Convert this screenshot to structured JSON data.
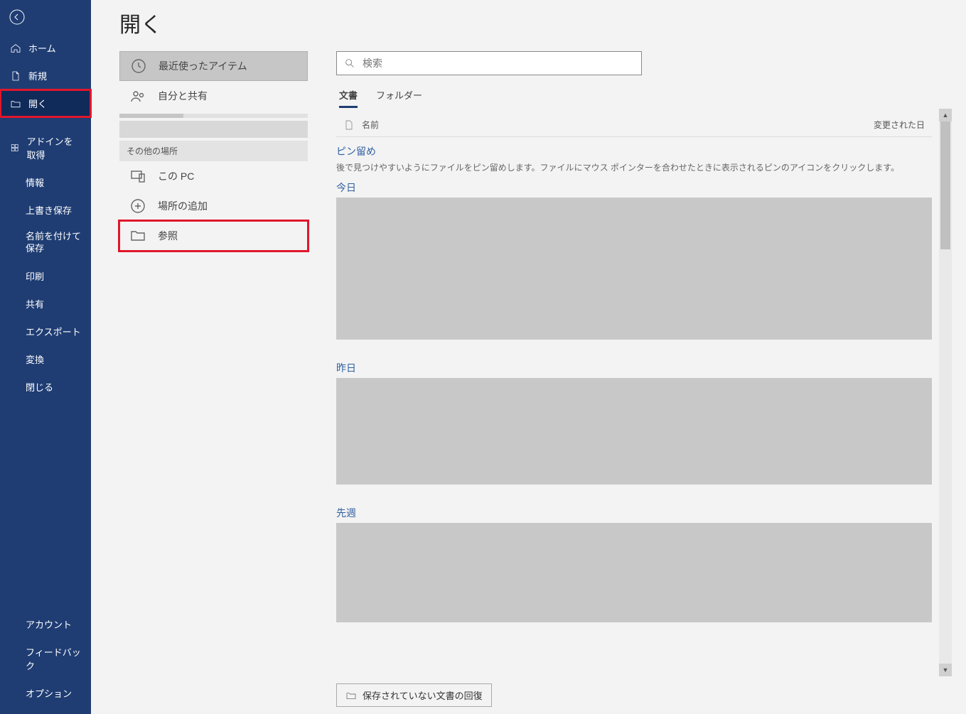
{
  "page_title": "開く",
  "sidebar": {
    "home": "ホーム",
    "new": "新規",
    "open": "開く",
    "addins": "アドインを取得",
    "info": "情報",
    "save": "上書き保存",
    "save_as": "名前を付けて保存",
    "print": "印刷",
    "share": "共有",
    "export": "エクスポート",
    "transform": "変換",
    "close": "閉じる",
    "account": "アカウント",
    "feedback": "フィードバック",
    "options": "オプション"
  },
  "locations": {
    "recent": "最近使ったアイテム",
    "shared": "自分と共有",
    "other_heading": "その他の場所",
    "this_pc": "この PC",
    "add_place": "場所の追加",
    "browse": "参照"
  },
  "right": {
    "search_placeholder": "検索",
    "tabs": {
      "documents": "文書",
      "folders": "フォルダー"
    },
    "columns": {
      "name": "名前",
      "modified": "変更された日"
    },
    "pinned_heading": "ピン留め",
    "pinned_desc": "後で見つけやすいようにファイルをピン留めします。ファイルにマウス ポインターを合わせたときに表示されるピンのアイコンをクリックします。",
    "today_heading": "今日",
    "yesterday_heading": "昨日",
    "lastweek_heading": "先週",
    "recover_unsaved": "保存されていない文書の回復"
  }
}
